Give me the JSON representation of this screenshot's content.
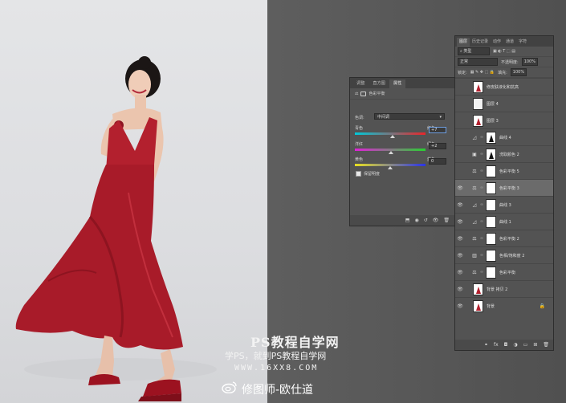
{
  "properties_panel": {
    "tabs": [
      "调整",
      "直方图",
      "属性"
    ],
    "active_tab": "属性",
    "header_label": "色彩平衡",
    "tone_label": "色调:",
    "tone_value": "中间调",
    "sliders": [
      {
        "left": "青色",
        "right": "红色",
        "value": "+7",
        "level": 0.53
      },
      {
        "left": "洋红",
        "right": "绿色",
        "value": "+2",
        "level": 0.51
      },
      {
        "left": "黄色",
        "right": "蓝色",
        "value": "0",
        "level": 0.5
      }
    ],
    "preserve_luminosity": "保留明度"
  },
  "layers_panel": {
    "tabs": [
      "图层",
      "历史记录",
      "动作",
      "通道",
      "字符"
    ],
    "active_tab": "图层",
    "filter_kind": "类型",
    "blend_mode": "正常",
    "opacity_label": "不透明度:",
    "opacity_value": "100%",
    "lock_label": "锁定:",
    "fill_label": "填充:",
    "fill_value": "100%",
    "layers": [
      {
        "name": "修皮肤液化和抗高",
        "visible": false,
        "type": "image",
        "thumb": "dress",
        "selected": false
      },
      {
        "name": "图层 4",
        "visible": false,
        "type": "image",
        "thumb": "blank",
        "selected": false
      },
      {
        "name": "图层 3",
        "visible": false,
        "type": "image",
        "thumb": "dress",
        "selected": false
      },
      {
        "name": "曲线 4",
        "visible": false,
        "type": "curves",
        "thumb": "black",
        "selected": false
      },
      {
        "name": "洗取颜色 2",
        "visible": false,
        "type": "selective",
        "thumb": "black",
        "selected": false
      },
      {
        "name": "色彩平衡 5",
        "visible": false,
        "type": "balance",
        "thumb": "white",
        "selected": false
      },
      {
        "name": "色彩平衡 3",
        "visible": true,
        "type": "balance",
        "thumb": "white",
        "selected": true
      },
      {
        "name": "曲线 3",
        "visible": true,
        "type": "curves",
        "thumb": "white",
        "selected": false
      },
      {
        "name": "曲线 1",
        "visible": true,
        "type": "curves",
        "thumb": "white",
        "selected": false
      },
      {
        "name": "色彩平衡 2",
        "visible": true,
        "type": "balance",
        "thumb": "white",
        "selected": false
      },
      {
        "name": "色相/饱和度 2",
        "visible": true,
        "type": "huesat",
        "thumb": "white",
        "selected": false
      },
      {
        "name": "色彩平衡",
        "visible": true,
        "type": "balance",
        "thumb": "white",
        "selected": false
      },
      {
        "name": "背景 拷贝 2",
        "visible": true,
        "type": "image",
        "thumb": "dress",
        "selected": false
      },
      {
        "name": "背景",
        "visible": true,
        "type": "image",
        "thumb": "dress",
        "selected": false,
        "locked": true
      }
    ]
  },
  "watermark": {
    "line1": "PS教程自学网",
    "line2": "学PS，就到PS教程自学网",
    "line3": "WWW.16XX8.COM",
    "line4": "修图师-欧仕道"
  },
  "colors": {
    "dress": "#b3202e",
    "panel": "#535353",
    "canvas": "#595959"
  }
}
